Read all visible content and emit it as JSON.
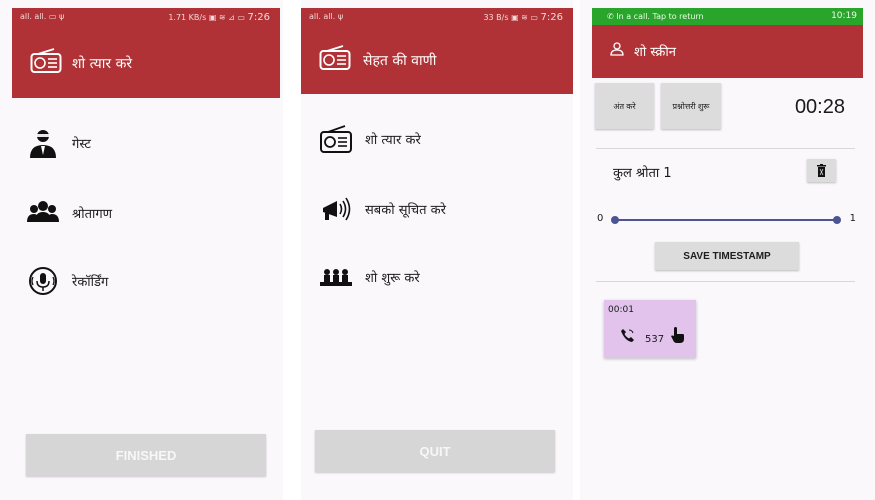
{
  "screen1": {
    "status": {
      "left": "all. all. ▭ ψ",
      "right": "1.71 KB/s ▣ ≋ ⊿ ▭ ",
      "time": "7:26"
    },
    "title": "शो त्यार करे",
    "items": [
      {
        "label": "गेस्ट",
        "icon": "guest-person-icon"
      },
      {
        "label": "श्रोतागण",
        "icon": "audience-group-icon"
      },
      {
        "label": "रेकॉर्डिंग",
        "icon": "microphone-icon"
      }
    ],
    "button": "FINISHED"
  },
  "screen2": {
    "status": {
      "left": "all. all. ψ",
      "right": "33 B/s ▣ ≋ ▭ ",
      "time": "7:26"
    },
    "title": "सेहत की वाणी",
    "items": [
      {
        "label": "शो त्यार करे",
        "icon": "radio-icon"
      },
      {
        "label": "सबको सूचित करे",
        "icon": "megaphone-icon"
      },
      {
        "label": "शो शुरू करे",
        "icon": "audience-show-icon"
      }
    ],
    "button": "QUIT"
  },
  "screen3": {
    "call_banner": "In a call. Tap to return",
    "time": "10:19",
    "title": "शो स्क्रीन",
    "end_button": "अंत करे",
    "qa_button": "प्रश्नोत्तरी शुरू",
    "timer": "00:28",
    "listeners": "कुल श्रोता 1",
    "slider_min": "0",
    "slider_max": "1",
    "slider_value": 1,
    "save_button": "SAVE TIMESTAMP",
    "card": {
      "time": "00:01",
      "number": "537"
    }
  },
  "colors": {
    "primary": "#b03236",
    "call_green": "#2aa52b",
    "card": "#e2c3ec",
    "slider": "#4a5591"
  }
}
